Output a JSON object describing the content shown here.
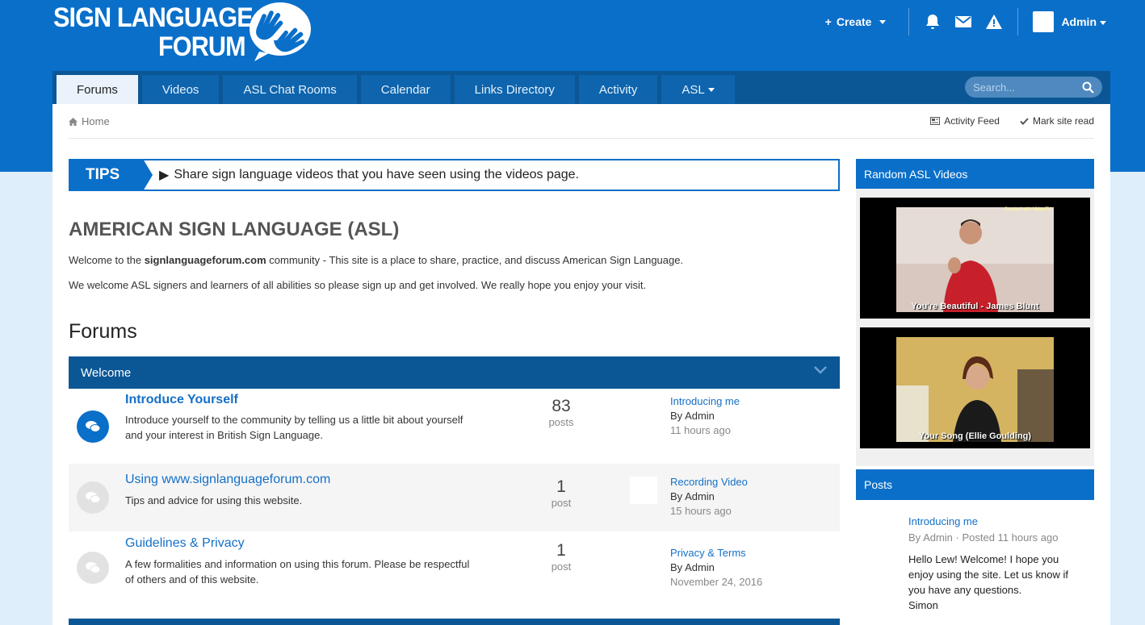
{
  "brand": {
    "line1": "SIGN LANGUAGE",
    "line2": "FORUM"
  },
  "userbar": {
    "create": "Create",
    "user": "Admin"
  },
  "nav": {
    "tabs": [
      "Forums",
      "Videos",
      "ASL Chat Rooms",
      "Calendar",
      "Links Directory",
      "Activity",
      "ASL"
    ],
    "active": "Forums",
    "search_placeholder": "Search..."
  },
  "breadcrumb": {
    "home": "Home"
  },
  "pagetools": {
    "activity": "Activity Feed",
    "mark_read": "Mark site read"
  },
  "tips": {
    "label": "TIPS",
    "text": "Share sign language videos that you have seen using the videos page."
  },
  "intro": {
    "title": "AMERICAN SIGN LANGUAGE (ASL)",
    "p1_pre": "Welcome to the ",
    "p1_bold": "signlanguageforum.com",
    "p1_post": " community - This site is a place to share, practice, and discuss American Sign Language.",
    "p2": "We welcome ASL signers and learners of all abilities so please sign up and get involved. We really hope you enjoy your visit."
  },
  "forums": {
    "heading": "Forums",
    "category": "Welcome",
    "rows": [
      {
        "title": "Introduce Yourself",
        "desc": "Introduce yourself to the community by telling us a little bit about yourself and your interest in British Sign Language.",
        "count": "83",
        "count_label": "posts",
        "last_title": "Introducing me",
        "last_by": "By Admin",
        "last_time": "11 hours ago"
      },
      {
        "title": "Using www.signlanguageforum.com",
        "desc": "Tips and advice for using this website.",
        "count": "1",
        "count_label": "post",
        "last_title": "Recording Video",
        "last_by": "By Admin",
        "last_time": "15 hours ago"
      },
      {
        "title": "Guidelines & Privacy",
        "desc": "A few formalities and information on using this forum.  Please be respectful of others and of this website.",
        "count": "1",
        "count_label": "post",
        "last_title": "Privacy & Terms",
        "last_by": "By Admin",
        "last_time": "November 24, 2016"
      }
    ]
  },
  "sidebar": {
    "videos_title": "Random ASL Videos",
    "videos": [
      {
        "caption": "You're Beautiful - James Blunt",
        "watermark": "Created with VideoFX"
      },
      {
        "caption": "Your Song (Ellie Goulding)"
      }
    ],
    "posts_title": "Posts",
    "post": {
      "title": "Introducing me",
      "meta": "By Admin · Posted 11 hours ago",
      "body1": "Hello Lew! Welcome!  I hope you",
      "body2": "enjoy using the site.   Let us know if",
      "body3": "you have any questions.",
      "body4": "Simon"
    }
  },
  "colors": {
    "brand_blue": "#0a6fc9",
    "nav_dark": "#0b5796",
    "link": "#1570c8"
  }
}
